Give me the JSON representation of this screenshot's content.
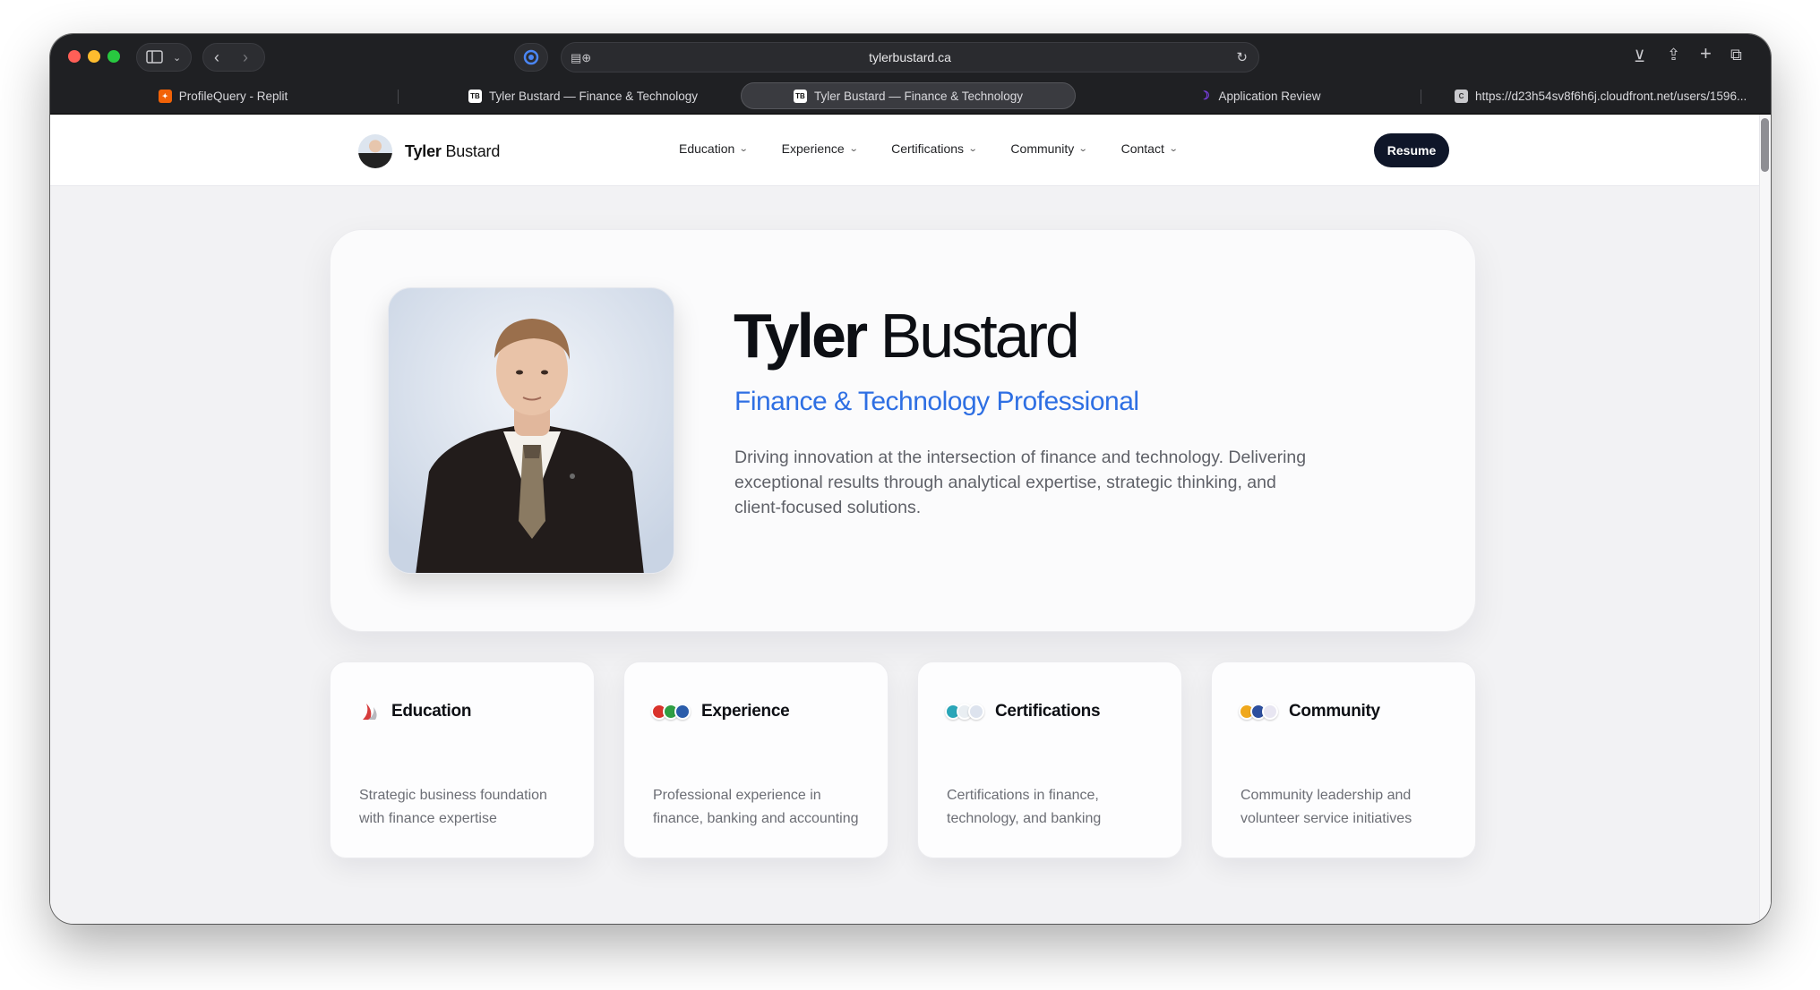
{
  "browser": {
    "url": "tylerbustard.ca",
    "tabs": [
      {
        "title": "ProfileQuery - Replit",
        "favicon_color": "#f26207"
      },
      {
        "title": "Tyler Bustard — Finance & Technology",
        "favicon_color": "#ffffff"
      },
      {
        "title": "Tyler Bustard — Finance & Technology",
        "favicon_color": "#ffffff",
        "active": true
      },
      {
        "title": "Application Review",
        "favicon_color": "#7b3fe4"
      },
      {
        "title": "https://d23h54sv8f6h6j.cloudfront.net/users/1596...",
        "favicon_color": "#c9c9cd"
      }
    ]
  },
  "nav": {
    "brand_first": "Tyler",
    "brand_last": "Bustard",
    "menu": [
      "Education",
      "Experience",
      "Certifications",
      "Community",
      "Contact"
    ],
    "resume_label": "Resume"
  },
  "hero": {
    "first_name": "Tyler",
    "last_name": "Bustard",
    "role": "Finance & Technology Professional",
    "description": "Driving innovation at the intersection of finance and technology. Delivering exceptional results through analytical expertise, strategic thinking, and client-focused solutions."
  },
  "cards": [
    {
      "title": "Education",
      "description": "Strategic business foundation with finance expertise"
    },
    {
      "title": "Experience",
      "description": "Professional experience in finance, banking and accounting"
    },
    {
      "title": "Certifications",
      "description": "Certifications in finance, technology, and banking"
    },
    {
      "title": "Community",
      "description": "Community leadership and volunteer service initiatives"
    }
  ],
  "colors": {
    "accent": "#2e6fe3",
    "resume_button": "#0f1629"
  }
}
